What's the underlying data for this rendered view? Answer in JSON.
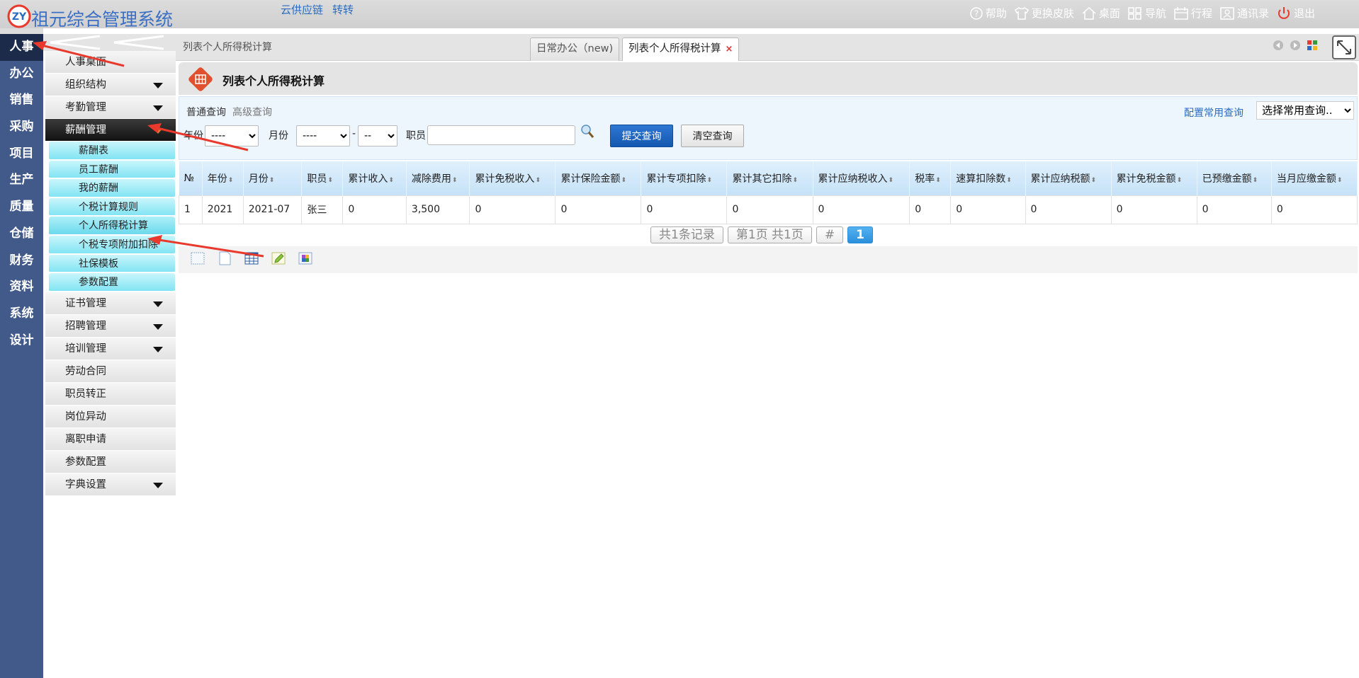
{
  "app": {
    "title": "祖元综合管理系统",
    "top_links": [
      "云供应链",
      "转转"
    ]
  },
  "topbar_right": [
    {
      "label": "帮助",
      "icon": "help-circle-icon"
    },
    {
      "label": "更换皮肤",
      "icon": "tshirt-icon"
    },
    {
      "label": "桌面",
      "icon": "home-icon"
    },
    {
      "label": "导航",
      "icon": "grid-icon"
    },
    {
      "label": "行程",
      "icon": "calendar-icon"
    },
    {
      "label": "通讯录",
      "icon": "contacts-icon"
    },
    {
      "label": "退出",
      "icon": "power-icon"
    }
  ],
  "modules": [
    "人事",
    "办公",
    "销售",
    "采购",
    "项目",
    "生产",
    "质量",
    "仓储",
    "财务",
    "资料",
    "系统",
    "设计"
  ],
  "sidebar": {
    "items": [
      {
        "label": "人事桌面"
      },
      {
        "label": "组织结构",
        "caret": true
      },
      {
        "label": "考勤管理",
        "caret": true
      },
      {
        "label": "薪酬管理",
        "caret": true,
        "open": true,
        "children": [
          "薪酬表",
          "员工薪酬",
          "我的薪酬",
          "个税计算规则",
          "个人所得税计算",
          "个税专项附加扣除",
          "社保模板",
          "参数配置"
        ]
      },
      {
        "label": "证书管理",
        "caret": true
      },
      {
        "label": "招聘管理",
        "caret": true
      },
      {
        "label": "培训管理",
        "caret": true
      },
      {
        "label": "劳动合同"
      },
      {
        "label": "职员转正"
      },
      {
        "label": "岗位异动"
      },
      {
        "label": "离职申请"
      },
      {
        "label": "参数配置"
      },
      {
        "label": "字典设置",
        "caret": true
      }
    ]
  },
  "tabs": {
    "breadcrumb": "列表个人所得税计算",
    "items": [
      {
        "label": "日常办公（new)"
      },
      {
        "label": "列表个人所得税计算",
        "close": "×"
      }
    ]
  },
  "page": {
    "title": "列表个人所得税计算"
  },
  "query": {
    "normal": "普通查询",
    "advanced": "高级查询",
    "config_link": "配置常用查询",
    "common_select": "选择常用查询..",
    "year_label": "年份",
    "year_value": "----",
    "month_label": "月份",
    "month_value": "----",
    "month_sep": "-",
    "month_value2": "--",
    "employee_label": "职员",
    "employee_value": "",
    "submit": "提交查询",
    "clear": "清空查询"
  },
  "table": {
    "columns": [
      "№",
      "年份",
      "月份",
      "职员",
      "累计收入",
      "减除费用",
      "累计免税收入",
      "累计保险金额",
      "累计专项扣除",
      "累计其它扣除",
      "累计应纳税收入",
      "税率",
      "速算扣除数",
      "累计应纳税额",
      "累计免税金额",
      "已预缴金额",
      "当月应缴金额"
    ],
    "sortable": [
      false,
      true,
      true,
      true,
      true,
      true,
      true,
      true,
      true,
      true,
      true,
      true,
      true,
      true,
      true,
      true,
      true
    ],
    "rows": [
      [
        "1",
        "2021",
        "2021-07",
        "张三",
        "0",
        "3,500",
        "0",
        "0",
        "0",
        "0",
        "0",
        "0",
        "0",
        "0",
        "0",
        "0",
        "0"
      ]
    ]
  },
  "pager": {
    "total": "共1条记录",
    "page_info": "第1页 共1页",
    "jump": "#",
    "current": "1"
  },
  "colors": {
    "rail": "#425a8a",
    "rail_active": "#1c2b4a",
    "accent_blue": "#2a6cc0",
    "submit": "#1f68c6",
    "arrow_red": "#e8392c",
    "pagehead_icon": "#e0502c"
  }
}
